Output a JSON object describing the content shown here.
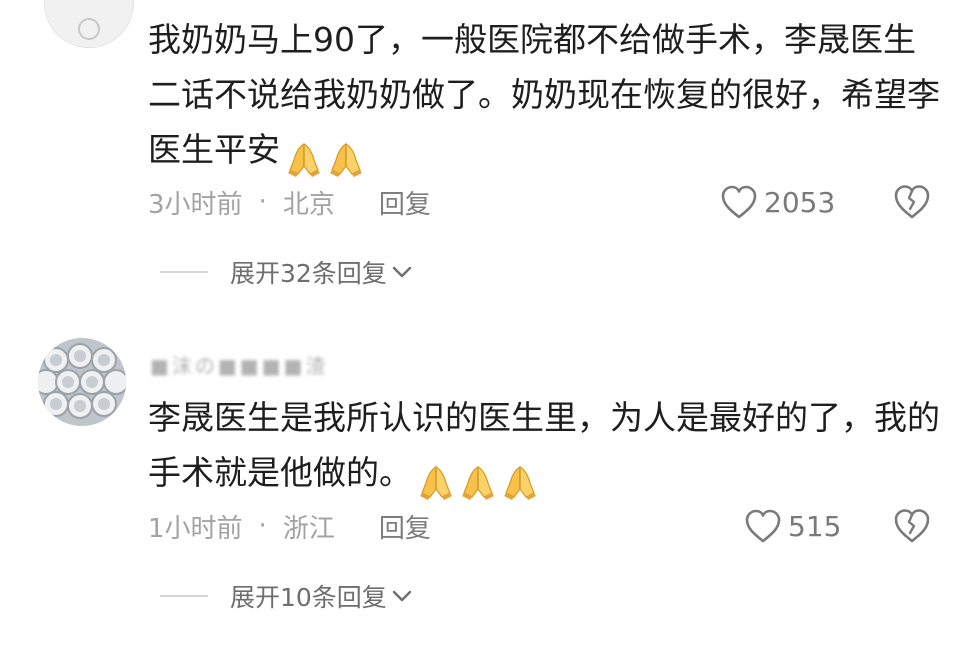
{
  "comments": [
    {
      "username": "",
      "text": "我奶奶马上90了，一般医院都不给做手术，李晟医生二话不说给我奶奶做了。奶奶现在恢复的很好，希望李医生平安",
      "emoji": [
        "folded-hands",
        "folded-hands"
      ],
      "time": "3小时前",
      "separator": "·",
      "location": "北京",
      "reply_label": "回复",
      "likes": "2053",
      "expand_label": "展开32条回复"
    },
    {
      "username": "■沫の■■■■渣",
      "text": "李晟医生是我所认识的医生里，为人是最好的了，我的手术就是他做的。",
      "emoji": [
        "folded-hands",
        "folded-hands",
        "folded-hands"
      ],
      "time": "1小时前",
      "separator": "·",
      "location": "浙江",
      "reply_label": "回复",
      "likes": "515",
      "expand_label": "展开10条回复"
    }
  ],
  "icons": {
    "like": "heart-outline-icon",
    "dislike": "broken-heart-icon",
    "expand": "chevron-down-icon"
  },
  "colors": {
    "text": "#1e1e1e",
    "meta": "#a3a3a3",
    "action": "#7a7a7a"
  }
}
